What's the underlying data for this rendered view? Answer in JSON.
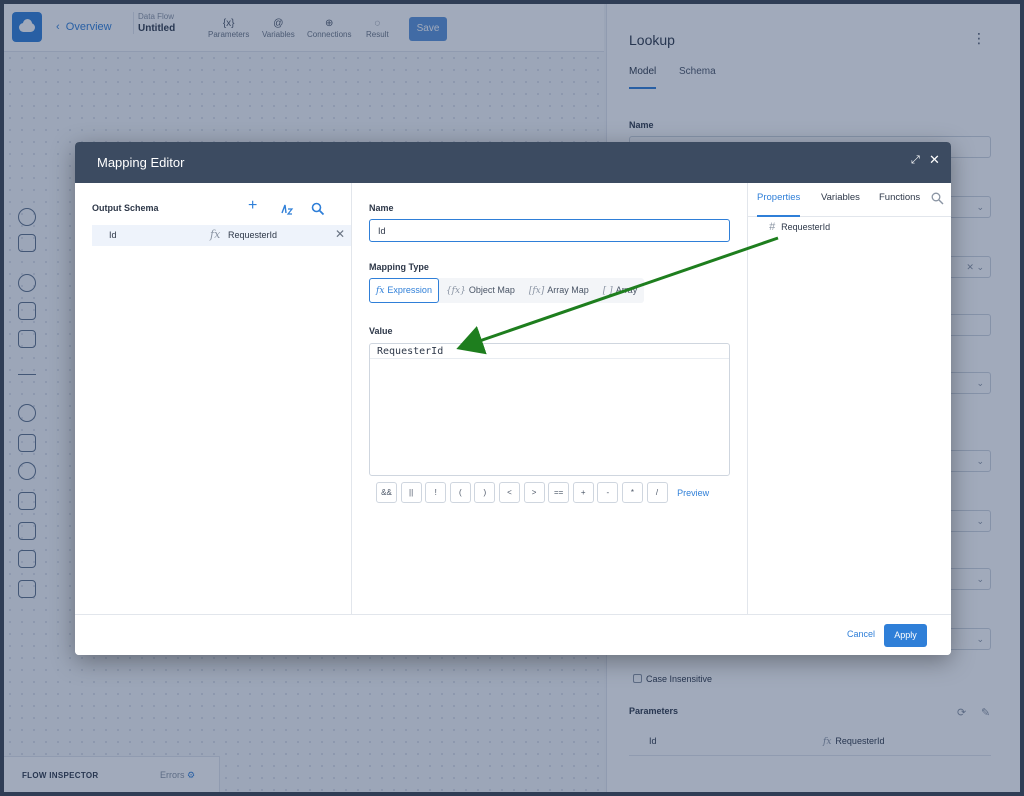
{
  "topbar": {
    "back_label": "Overview",
    "flow_type": "Data Flow",
    "flow_name": "Untitled",
    "tools": [
      {
        "label": "Parameters",
        "icon": "{x}"
      },
      {
        "label": "Variables",
        "icon": "@"
      },
      {
        "label": "Connections",
        "icon": "⊕"
      },
      {
        "label": "Result",
        "icon": "◌"
      }
    ],
    "save_label": "Save"
  },
  "inspector": {
    "title": "FLOW INSPECTOR",
    "errors_label": "Errors"
  },
  "right_panel": {
    "title": "Lookup",
    "tabs": [
      "Model",
      "Schema"
    ],
    "name_label": "Name",
    "case_insensitive_label": "Case Insensitive",
    "parameters_label": "Parameters",
    "param_row": {
      "name": "Id",
      "value": "RequesterId"
    }
  },
  "modal": {
    "title": "Mapping Editor",
    "output_schema": {
      "title": "Output Schema",
      "rows": [
        {
          "name": "Id",
          "value": "RequesterId"
        }
      ]
    },
    "name_label": "Name",
    "name_value": "Id",
    "mapping_type_label": "Mapping Type",
    "mapping_types": [
      "Expression",
      "Object Map",
      "Array Map",
      "Array"
    ],
    "mapping_type_icons": [
      "fx",
      "{fx}",
      "[fx]",
      "[ ]"
    ],
    "value_label": "Value",
    "value_text": "RequesterId",
    "operators": [
      "&&",
      "||",
      "!",
      "(",
      ")",
      "<",
      ">",
      "==",
      "+",
      "-",
      "*",
      "/"
    ],
    "preview_label": "Preview",
    "right_tabs": [
      "Properties",
      "Variables",
      "Functions"
    ],
    "properties": [
      "RequesterId"
    ],
    "cancel_label": "Cancel",
    "apply_label": "Apply"
  },
  "colors": {
    "accent": "#2f7fd8",
    "modal_header": "#3c4b61",
    "annotation_arrow": "#1e7e1e"
  }
}
